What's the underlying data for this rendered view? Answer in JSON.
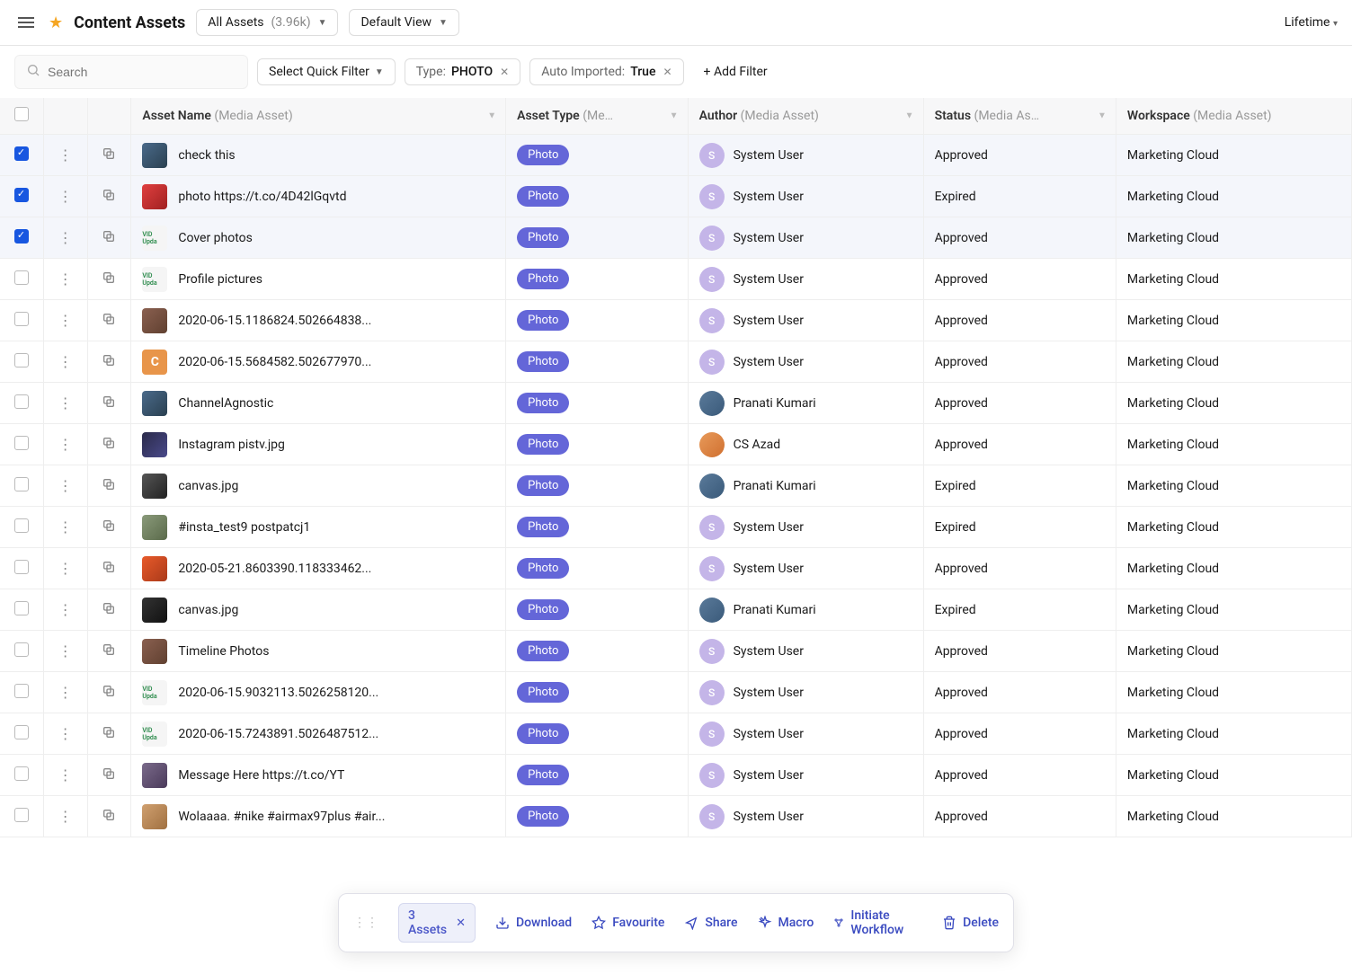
{
  "header": {
    "title": "Content Assets",
    "all_assets_label": "All Assets",
    "all_assets_count": "(3.96k)",
    "view_label": "Default View",
    "lifetime_label": "Lifetime"
  },
  "filters": {
    "search_placeholder": "Search",
    "quick_filter_label": "Select Quick Filter",
    "type_label": "Type:",
    "type_value": "PHOTO",
    "auto_imported_label": "Auto Imported:",
    "auto_imported_value": "True",
    "add_filter_label": "+ Add Filter"
  },
  "columns": {
    "asset_name": {
      "label": "Asset Name",
      "sub": "(Media Asset)"
    },
    "asset_type": {
      "label": "Asset Type",
      "sub": "(Me…"
    },
    "author": {
      "label": "Author",
      "sub": "(Media Asset)"
    },
    "status": {
      "label": "Status",
      "sub": "(Media As…"
    },
    "workspace": {
      "label": "Workspace",
      "sub": "(Media Asset)"
    }
  },
  "rows": [
    {
      "selected": true,
      "name": "check this",
      "thumb": "photo1",
      "type": "Photo",
      "author": "System User",
      "avatar": "system",
      "initial": "S",
      "status": "Approved",
      "workspace": "Marketing Cloud"
    },
    {
      "selected": true,
      "name": "photo https://t.co/4D42lGqvtd",
      "thumb": "red",
      "type": "Photo",
      "author": "System User",
      "avatar": "system",
      "initial": "S",
      "status": "Expired",
      "workspace": "Marketing Cloud"
    },
    {
      "selected": true,
      "name": "Cover photos",
      "thumb": "green-text",
      "type": "Photo",
      "author": "System User",
      "avatar": "system",
      "initial": "S",
      "status": "Approved",
      "workspace": "Marketing Cloud"
    },
    {
      "selected": false,
      "name": "Profile pictures",
      "thumb": "green-text",
      "type": "Photo",
      "author": "System User",
      "avatar": "system",
      "initial": "S",
      "status": "Approved",
      "workspace": "Marketing Cloud"
    },
    {
      "selected": false,
      "name": "2020-06-15.1186824.502664838...",
      "thumb": "brick",
      "type": "Photo",
      "author": "System User",
      "avatar": "system",
      "initial": "S",
      "status": "Approved",
      "workspace": "Marketing Cloud"
    },
    {
      "selected": false,
      "name": "2020-06-15.5684582.502677970...",
      "thumb": "orange-c",
      "type": "Photo",
      "author": "System User",
      "avatar": "system",
      "initial": "S",
      "status": "Approved",
      "workspace": "Marketing Cloud"
    },
    {
      "selected": false,
      "name": "ChannelAgnostic",
      "thumb": "photo1",
      "type": "Photo",
      "author": "Pranati Kumari",
      "avatar": "pk",
      "initial": "",
      "status": "Approved",
      "workspace": "Marketing Cloud"
    },
    {
      "selected": false,
      "name": "Instagram pistv.jpg",
      "thumb": "night",
      "type": "Photo",
      "author": "CS Azad",
      "avatar": "cs",
      "initial": "",
      "status": "Approved",
      "workspace": "Marketing Cloud"
    },
    {
      "selected": false,
      "name": "canvas.jpg",
      "thumb": "bw",
      "type": "Photo",
      "author": "Pranati Kumari",
      "avatar": "pk",
      "initial": "",
      "status": "Expired",
      "workspace": "Marketing Cloud"
    },
    {
      "selected": false,
      "name": "#insta_test9 postpatcj1",
      "thumb": "street",
      "type": "Photo",
      "author": "System User",
      "avatar": "system",
      "initial": "S",
      "status": "Expired",
      "workspace": "Marketing Cloud"
    },
    {
      "selected": false,
      "name": "2020-05-21.8603390.118333462...",
      "thumb": "flower",
      "type": "Photo",
      "author": "System User",
      "avatar": "system",
      "initial": "S",
      "status": "Approved",
      "workspace": "Marketing Cloud"
    },
    {
      "selected": false,
      "name": "canvas.jpg",
      "thumb": "dark",
      "type": "Photo",
      "author": "Pranati Kumari",
      "avatar": "pk",
      "initial": "",
      "status": "Expired",
      "workspace": "Marketing Cloud"
    },
    {
      "selected": false,
      "name": "Timeline Photos",
      "thumb": "brick",
      "type": "Photo",
      "author": "System User",
      "avatar": "system",
      "initial": "S",
      "status": "Approved",
      "workspace": "Marketing Cloud"
    },
    {
      "selected": false,
      "name": "2020-06-15.9032113.5026258120...",
      "thumb": "green-text",
      "type": "Photo",
      "author": "System User",
      "avatar": "system",
      "initial": "S",
      "status": "Approved",
      "workspace": "Marketing Cloud"
    },
    {
      "selected": false,
      "name": "2020-06-15.7243891.5026487512...",
      "thumb": "green-text",
      "type": "Photo",
      "author": "System User",
      "avatar": "system",
      "initial": "S",
      "status": "Approved",
      "workspace": "Marketing Cloud"
    },
    {
      "selected": false,
      "name": "Message Here https://t.co/YT",
      "thumb": "people",
      "type": "Photo",
      "author": "System User",
      "avatar": "system",
      "initial": "S",
      "status": "Approved",
      "workspace": "Marketing Cloud"
    },
    {
      "selected": false,
      "name": "Wolaaaa. #nike #airmax97plus #air...",
      "thumb": "beach",
      "type": "Photo",
      "author": "System User",
      "avatar": "system",
      "initial": "S",
      "status": "Approved",
      "workspace": "Marketing Cloud"
    }
  ],
  "action_bar": {
    "count_label": "3 Assets",
    "download": "Download",
    "favourite": "Favourite",
    "share": "Share",
    "macro": "Macro",
    "workflow": "Initiate Workflow",
    "delete": "Delete"
  },
  "thumb_text": {
    "green-text": "VID Upda",
    "orange-c": "C"
  }
}
